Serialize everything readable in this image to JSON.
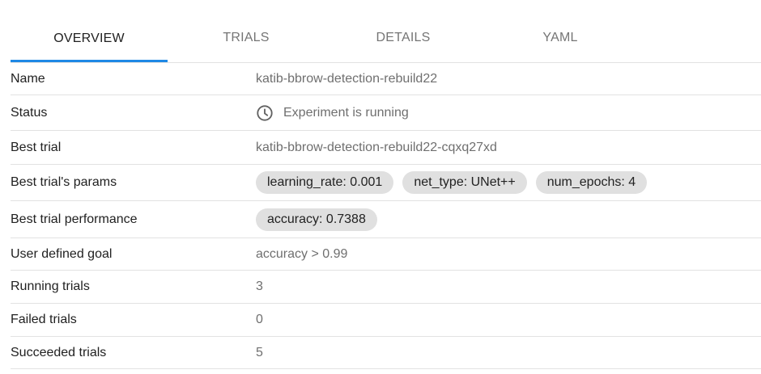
{
  "tabs": [
    {
      "label": "OVERVIEW",
      "active": true
    },
    {
      "label": "TRIALS",
      "active": false
    },
    {
      "label": "DETAILS",
      "active": false
    },
    {
      "label": "YAML",
      "active": false
    }
  ],
  "overview": {
    "name": {
      "label": "Name",
      "value": "katib-bbrow-detection-rebuild22"
    },
    "status": {
      "label": "Status",
      "value": "Experiment is running",
      "icon": "clock-icon"
    },
    "best_trial": {
      "label": "Best trial",
      "value": "katib-bbrow-detection-rebuild22-cqxq27xd"
    },
    "best_trial_params": {
      "label": "Best trial's params",
      "chips": [
        "learning_rate: 0.001",
        "net_type: UNet++",
        "num_epochs: 4"
      ]
    },
    "best_trial_performance": {
      "label": "Best trial performance",
      "chips": [
        "accuracy: 0.7388"
      ]
    },
    "user_defined_goal": {
      "label": "User defined goal",
      "value": "accuracy > 0.99"
    },
    "running_trials": {
      "label": "Running trials",
      "value": "3"
    },
    "failed_trials": {
      "label": "Failed trials",
      "value": "0"
    },
    "succeeded_trials": {
      "label": "Succeeded trials",
      "value": "5"
    }
  },
  "colors": {
    "accent": "#1e88e5",
    "chip_bg": "#e0e0e0",
    "divider": "#e2e2e2"
  }
}
